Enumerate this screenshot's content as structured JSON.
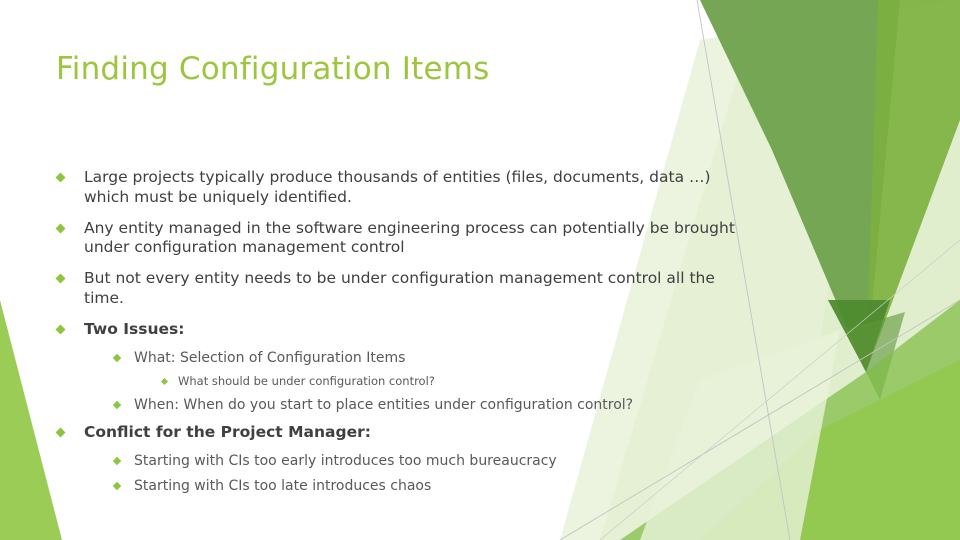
{
  "slide": {
    "title": "Finding Configuration Items",
    "title_color": "#9CC63E",
    "body_color": "#404040",
    "sub_body_color": "#595959",
    "bullet_color": "#8CC63E",
    "background_color": "#FFFFFF",
    "accent_colors": {
      "bright_green": "#8DC63F",
      "mid_green": "#74A24F",
      "dark_green": "#4E8A2E",
      "pale_green": "#DCEBC8",
      "light_green": "#C5DFA0",
      "guide_line": "#BFBFBF"
    }
  },
  "content": {
    "bullets": [
      {
        "level": 1,
        "bold": false,
        "text": "Large projects typically produce thousands of entities (files, documents, data …) which must be uniquely identified."
      },
      {
        "level": 1,
        "bold": false,
        "text": "Any entity  managed in the software engineering process can potentially be brought under configuration management control"
      },
      {
        "level": 1,
        "bold": false,
        "text": "But not every entity needs to be under configuration management control all the time."
      },
      {
        "level": 1,
        "bold": true,
        "text": "Two Issues:"
      },
      {
        "level": 2,
        "bold": false,
        "text": "What: Selection of Configuration Items"
      },
      {
        "level": 3,
        "bold": false,
        "text": "What should be under configuration control?"
      },
      {
        "level": 2,
        "bold": false,
        "text": "When: When do you start to place entities under configuration control?"
      },
      {
        "level": 1,
        "bold": true,
        "text": "Conflict for the Project Manager:"
      },
      {
        "level": 2,
        "bold": false,
        "text": "Starting with CIs too early introduces too much bureaucracy"
      },
      {
        "level": 2,
        "bold": false,
        "text": "Starting with CIs too late introduces chaos"
      }
    ]
  }
}
